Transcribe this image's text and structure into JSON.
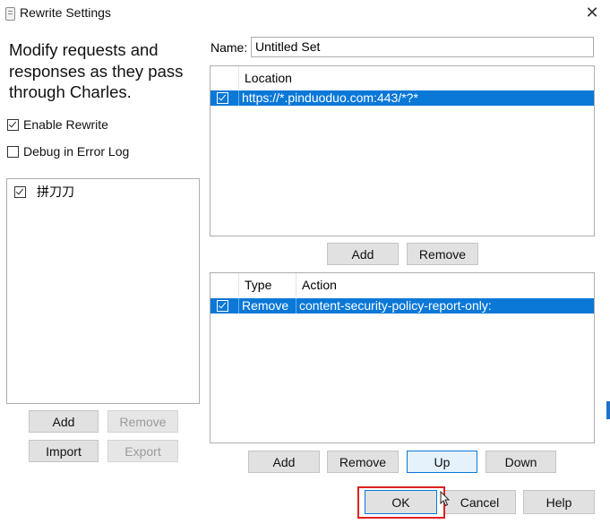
{
  "window": {
    "title": "Rewrite Settings",
    "close_glyph": "✕"
  },
  "left": {
    "description": "Modify requests and responses as they pass through Charles.",
    "enable_rewrite": {
      "label": "Enable Rewrite",
      "checked": true
    },
    "debug_error_log": {
      "label": "Debug in Error Log",
      "checked": false
    },
    "sets": [
      {
        "name": "拼刀刀",
        "checked": true
      }
    ],
    "buttons": {
      "add": "Add",
      "remove": "Remove",
      "import": "Import",
      "export": "Export"
    }
  },
  "name_field": {
    "label": "Name:",
    "value": "Untitled Set"
  },
  "locations": {
    "header": "Location",
    "rows": [
      {
        "checked": true,
        "location": "https://*.pinduoduo.com:443/*?*"
      }
    ],
    "buttons": {
      "add": "Add",
      "remove": "Remove"
    }
  },
  "rules": {
    "headers": {
      "type": "Type",
      "action": "Action"
    },
    "rows": [
      {
        "checked": true,
        "type": "Remove",
        "action": "content-security-policy-report-only:"
      }
    ],
    "buttons": {
      "add": "Add",
      "remove": "Remove",
      "up": "Up",
      "down": "Down"
    }
  },
  "footer": {
    "ok": "OK",
    "cancel": "Cancel",
    "help": "Help"
  },
  "colors": {
    "selection": "#0a78d7",
    "focus_annotation": "#e02020",
    "button_bg": "#e1e1e1"
  }
}
